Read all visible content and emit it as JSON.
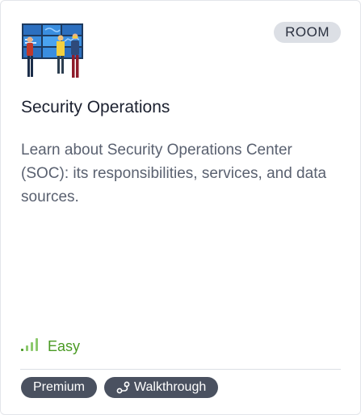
{
  "card": {
    "illustration_icon": "soc-team-illustration",
    "type_badge": "ROOM",
    "title": "Security Operations",
    "description": "Learn about Security Operations Center (SOC): its responsibilities, services, and data sources.",
    "difficulty": {
      "label": "Easy",
      "icon": "signal-bars-icon",
      "color": "#4a9a24"
    },
    "tags": [
      {
        "label": "Premium"
      },
      {
        "label": "Walkthrough",
        "icon": "route-icon"
      }
    ]
  }
}
